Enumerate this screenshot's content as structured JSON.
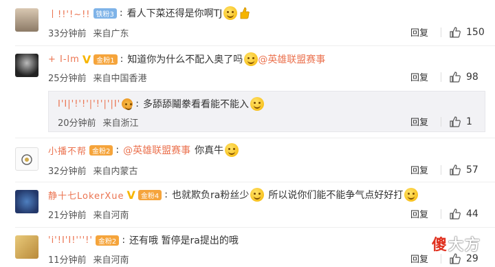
{
  "comments": [
    {
      "username": "丨!!'!~!!",
      "badge": "铁粉3",
      "text": "看人下菜还得是你啊TJ",
      "emoji": [
        "smile-emoji",
        "thumbs-up-emoji"
      ],
      "time": "33分钟前",
      "source": "来自广东",
      "reply": "回复",
      "likes": "150"
    },
    {
      "username": "+ I-lm",
      "badge": "金粉1",
      "text": "知道你为什么不配入奥了吗",
      "mention": "@英雄联盟赛事",
      "time": "25分钟前",
      "source": "来自中国香港",
      "reply": "回复",
      "likes": "98"
    },
    {
      "username": "I'I|'!'!'|'!'|'|I'",
      "text": "多舔舔鬮豢看看能不能入",
      "time": "20分钟前",
      "source": "来自浙江",
      "reply": "回复",
      "likes": "1"
    },
    {
      "username": "小播不帮",
      "badge": "金粉2",
      "mention": "@英雄联盟赛事",
      "text": "你真牛",
      "time": "32分钟前",
      "source": "来自内蒙古",
      "reply": "回复",
      "likes": "57"
    },
    {
      "username": "静十七LokerXue",
      "badge": "金粉4",
      "text": "也就欺负ra粉丝少",
      "text2": "所以说你们能不能争气点好好打",
      "time": "21分钟前",
      "source": "来自河南",
      "reply": "回复",
      "likes": "44"
    },
    {
      "username": "'i'!I'I!'''!'",
      "badge": "金粉2",
      "text": "还有哦 暂停是ra提出的哦",
      "time": "11分钟前",
      "source": "来自河南",
      "reply": "回复",
      "likes": "29"
    }
  ],
  "watermark": {
    "part1": "傻",
    "part2": "大方"
  },
  "colors": {
    "username": "#eb7350",
    "mention": "#eb7350",
    "badge_blue": "#7eb3e8",
    "badge_orange": "#f5a43b",
    "v_mark": "#f7b500"
  }
}
